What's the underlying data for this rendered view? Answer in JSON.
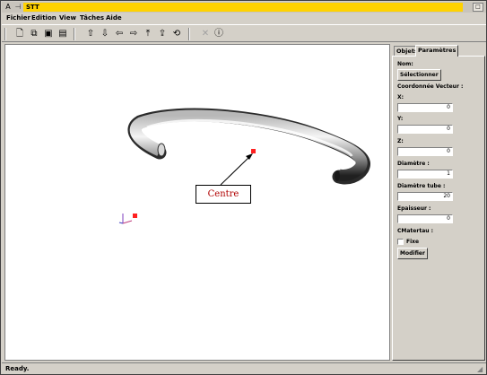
{
  "window": {
    "title": "STT",
    "sys_glyph": "A",
    "pin_glyph": "⊣"
  },
  "menu": [
    "Fichier",
    "Edition",
    "View",
    "Tâches",
    "Aide"
  ],
  "toolbar": {
    "icons": [
      "new-file-icon",
      "open-icon",
      "save-icon",
      "save-as-icon",
      "move-up-icon",
      "move-down-icon",
      "move-left-icon",
      "move-right-icon",
      "move-front-icon",
      "move-back-icon",
      "rotate-icon",
      "delete-icon",
      "info-icon"
    ]
  },
  "viewport": {
    "callout_label": "Centre",
    "marker_color": "#ff2020"
  },
  "panel": {
    "tabs": [
      "Objets",
      "Paramètres"
    ],
    "nom_label": "Nom:",
    "select_button": "Sélectionner",
    "coords_label": "Coordonnée Vecteur :",
    "x_label": "X:",
    "x_value": "0",
    "y_label": "Y:",
    "y_value": "0",
    "z_label": "Z:",
    "z_value": "0",
    "diametre_label": "Diamètre :",
    "diametre_value": "1",
    "diametre_tube_label": "Diamètre tube :",
    "diametre_tube_value": "20",
    "epaisseur_label": "Epaisseur :",
    "epaisseur_value": "0",
    "cmateriau_label": "CMatertau :",
    "fixe_label": "Fixe",
    "modify_button": "Modifier"
  },
  "status": {
    "text": "Ready."
  }
}
